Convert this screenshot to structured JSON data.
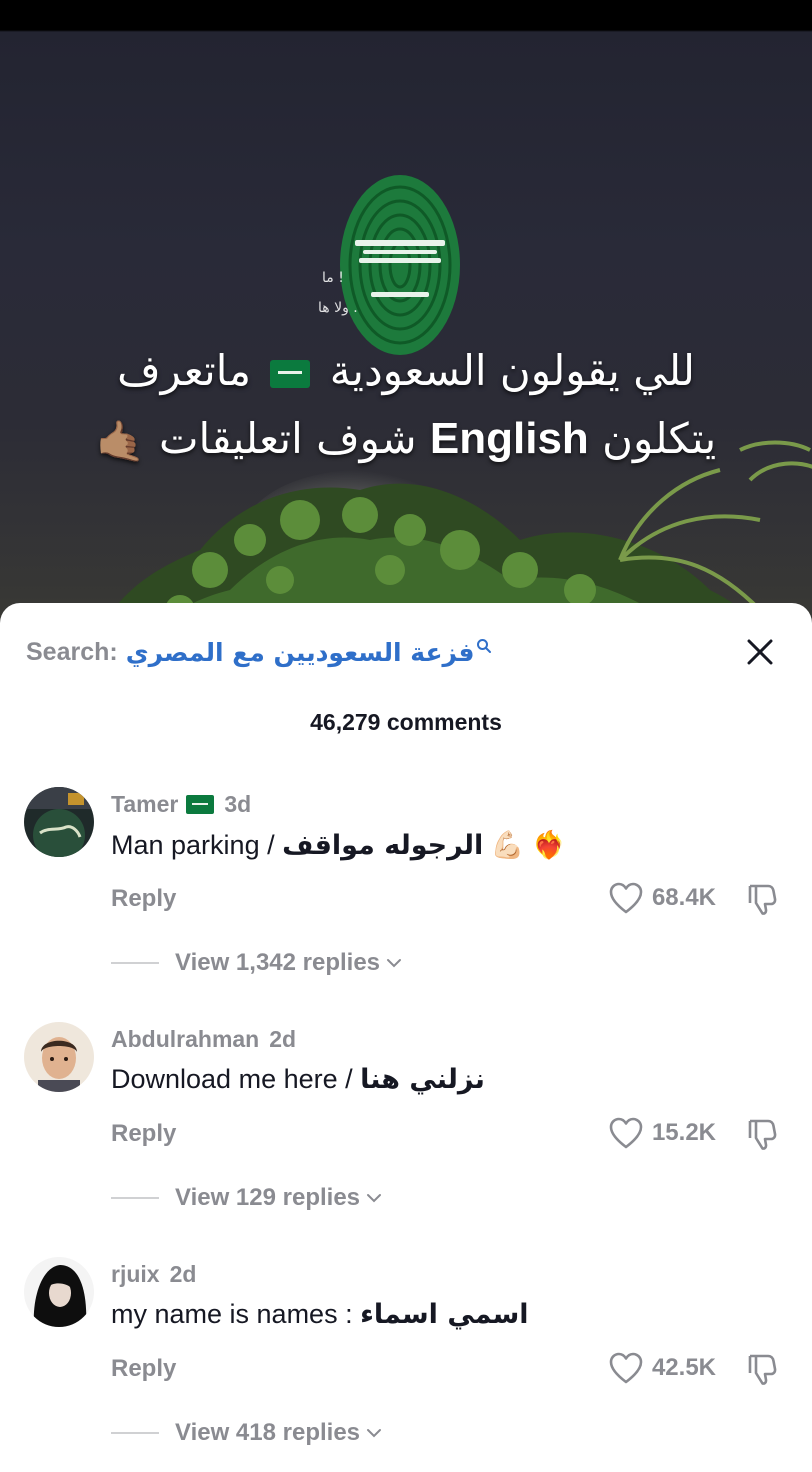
{
  "video": {
    "overlay_line1": "للي يقولون السعودية",
    "overlay_line1_end": "ماتعرف",
    "overlay_line2_start": "يتكلون",
    "overlay_line2_en": "English",
    "overlay_line2_end": "شوف اتعليقات",
    "faint_line1": "ما                !",
    "faint_line2": "ولا                    ها ."
  },
  "search": {
    "label": "Search:",
    "query": "فزعة السعوديين مع المصري"
  },
  "comments_count": "46,279 comments",
  "comments": [
    {
      "username": "Tamer",
      "has_flag": true,
      "time": "3d",
      "text_en": "Man parking / ",
      "text_ar": "الرجوله مواقف",
      "emoji": "💪🏻 ❤️‍🔥",
      "reply_label": "Reply",
      "likes": "68.4K",
      "view_replies": "View 1,342 replies"
    },
    {
      "username": "Abdulrahman",
      "has_flag": false,
      "time": "2d",
      "text_en": "Download me here / ",
      "text_ar": "نزلني هنا",
      "emoji": "",
      "reply_label": "Reply",
      "likes": "15.2K",
      "view_replies": "View 129 replies"
    },
    {
      "username": "rjuix",
      "has_flag": false,
      "time": "2d",
      "text_en": "my name is names : ",
      "text_ar": "اسمي اسماء",
      "emoji": "",
      "reply_label": "Reply",
      "likes": "42.5K",
      "view_replies": "View 418 replies"
    }
  ],
  "colors": {
    "accent_link": "#2f6fc9",
    "muted_text": "#8a8b91",
    "primary_text": "#161823",
    "flag_green": "#0b7a3e"
  }
}
